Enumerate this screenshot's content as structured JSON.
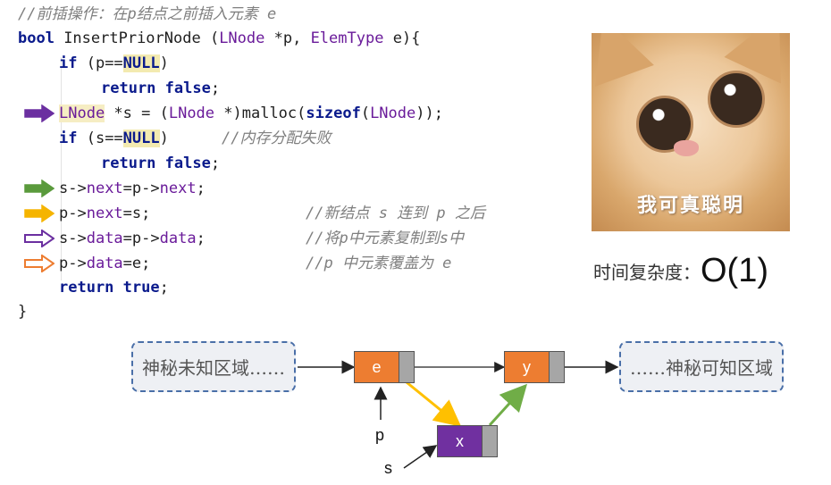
{
  "code": {
    "comment_title": "//前插操作：在p结点之前插入元素 e",
    "sig_kw": "bool",
    "sig_rest": " InsertPriorNode (",
    "sig_type1": "LNode",
    "sig_mid": " *p, ",
    "sig_type2": "ElemType",
    "sig_end": " e){",
    "l2_if": "if",
    "l2_a": " (p==",
    "l2_null": "NULL",
    "l2_b": ")",
    "l3_ret": "return",
    "l3_false": "false",
    "l3_end": ";",
    "l4_type": "LNode",
    "l4_a": " *s = (",
    "l4_type2": "LNode",
    "l4_b": " *)malloc(",
    "l4_sizeof": "sizeof",
    "l4_c": "(",
    "l4_type3": "LNode",
    "l4_d": "));",
    "l5_if": "if",
    "l5_a": " (s==",
    "l5_null": "NULL",
    "l5_b": ")",
    "l5_cmt": "//内存分配失败",
    "l6_ret": "return",
    "l6_false": "false",
    "l6_end": ";",
    "l7_a": "s->",
    "l7_f1": "next",
    "l7_b": "=p->",
    "l7_f2": "next",
    "l7_c": ";",
    "l8_a": "p->",
    "l8_f1": "next",
    "l8_b": "=s;",
    "l8_cmt": "//新结点 s 连到 p 之后",
    "l9_a": "s->",
    "l9_f1": "data",
    "l9_b": "=p->",
    "l9_f2": "data",
    "l9_c": ";",
    "l9_cmt": "//将p中元素复制到s中",
    "l10_a": "p->",
    "l10_f1": "data",
    "l10_b": "=e;",
    "l10_cmt": "//p 中元素覆盖为 e",
    "l11_ret": "return",
    "l11_true": "true",
    "l11_end": ";",
    "close": "}"
  },
  "arrows": [
    {
      "line": 4,
      "color": "#6b2fa0",
      "style": "filled"
    },
    {
      "line": 7,
      "color": "#5a9a3c",
      "style": "filled"
    },
    {
      "line": 8,
      "color": "#f5b400",
      "style": "filled"
    },
    {
      "line": 9,
      "color": "#6b2fa0",
      "style": "outline"
    },
    {
      "line": 10,
      "color": "#ed7d31",
      "style": "outline"
    }
  ],
  "meme": {
    "caption": "我可真聪明"
  },
  "complexity": {
    "label": "时间复杂度：",
    "value": "O(1)"
  },
  "diagram": {
    "left_region": "神秘未知区域……",
    "right_region": "……神秘可知区域",
    "node_e": {
      "label": "e",
      "color": "#ed7d31"
    },
    "node_y": {
      "label": "y",
      "color": "#ed7d31"
    },
    "node_x": {
      "label": "x",
      "color": "#7030a0"
    },
    "pointer_p": "p",
    "pointer_s": "s",
    "link_colors": {
      "e_to_x": "#ffc000",
      "x_to_y": "#70ad47",
      "plain": "#222222"
    }
  }
}
